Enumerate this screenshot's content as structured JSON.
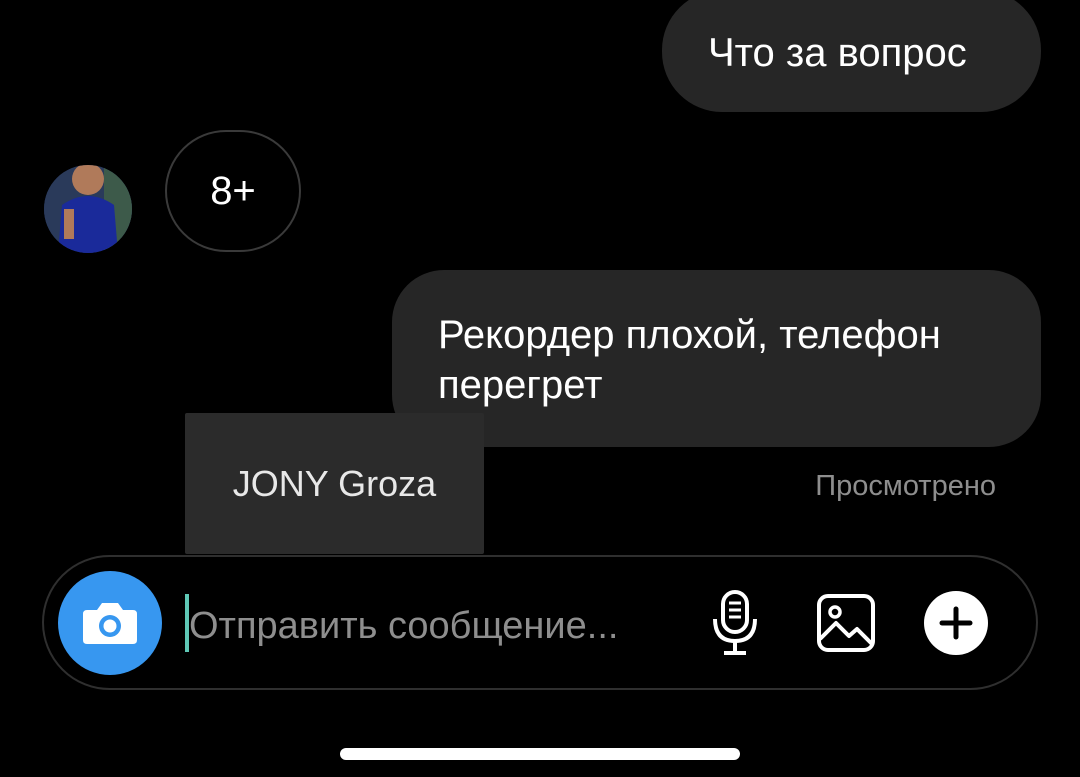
{
  "messages": {
    "outgoing_1": "Что за вопрос",
    "reply_preview": "8+",
    "outgoing_2": "Рекордер плохой, телефон перегрет"
  },
  "tooltip": {
    "name": "JONY Groza"
  },
  "status": {
    "seen": "Просмотрено"
  },
  "composer": {
    "placeholder": "Отправить сообщение..."
  },
  "icons": {
    "camera": "camera-icon",
    "microphone": "microphone-icon",
    "gallery": "image-icon",
    "add": "plus-icon"
  },
  "colors": {
    "background": "#000000",
    "bubble": "#262626",
    "accent": "#3797f0",
    "caret": "#5fc8b6",
    "muted_text": "#8e8e8e"
  }
}
